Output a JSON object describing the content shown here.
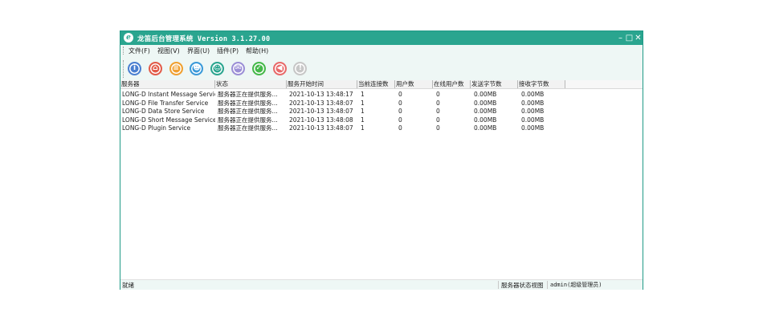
{
  "window": {
    "title": "龙笛后台管理系统 Version 3.1.27.00",
    "controls": {
      "minimize": "–",
      "maximize": "□",
      "close": "✕"
    }
  },
  "menu": [
    "文件(F)",
    "视图(V)",
    "界面(U)",
    "插件(P)",
    "帮助(H)"
  ],
  "toolbar": [
    {
      "icon": "user-info-icon",
      "color": "#4a7fd0",
      "glyph": "i"
    },
    {
      "icon": "home-icon",
      "color": "#e25c4a",
      "glyph": "⌂"
    },
    {
      "icon": "list-icon",
      "color": "#f0a030",
      "glyph": "≡"
    },
    {
      "icon": "contact-icon",
      "color": "#3a9ad9",
      "glyph": "☻"
    },
    {
      "icon": "org-icon",
      "color": "#2aa58f",
      "glyph": "☺"
    },
    {
      "icon": "message-icon",
      "color": "#9b8fd6",
      "glyph": "✉"
    },
    {
      "icon": "shield-check-icon",
      "color": "#45b94a",
      "glyph": "✓"
    },
    {
      "icon": "speaker-icon",
      "color": "#e86a6a",
      "glyph": "◀"
    },
    {
      "icon": "info-icon",
      "color": "#c7c7c7",
      "glyph": "!"
    }
  ],
  "table": {
    "columns": [
      "服务器",
      "状态",
      "服务开始时间",
      "当前连接数",
      "用户数",
      "在线用户数",
      "发送字节数",
      "接收字节数"
    ],
    "rows": [
      [
        "LONG-D Instant Message Service",
        "服务器正在提供服务...",
        "2021-10-13 13:48:17",
        "1",
        "0",
        "0",
        "0.00MB",
        "0.00MB"
      ],
      [
        "LONG-D File Transfer Service",
        "服务器正在提供服务...",
        "2021-10-13 13:48:07",
        "1",
        "0",
        "0",
        "0.00MB",
        "0.00MB"
      ],
      [
        "LONG-D Data Store Service",
        "服务器正在提供服务...",
        "2021-10-13 13:48:07",
        "1",
        "0",
        "0",
        "0.00MB",
        "0.00MB"
      ],
      [
        "LONG-D Short Message Service",
        "服务器正在提供服务...",
        "2021-10-13 13:48:08",
        "1",
        "0",
        "0",
        "0.00MB",
        "0.00MB"
      ],
      [
        "LONG-D Plugin Service",
        "服务器正在提供服务...",
        "2021-10-13 13:48:07",
        "1",
        "0",
        "0",
        "0.00MB",
        "0.00MB"
      ]
    ]
  },
  "status": {
    "ready": "就绪",
    "view": "服务器状态视图",
    "user": "admin(超级管理员)"
  }
}
